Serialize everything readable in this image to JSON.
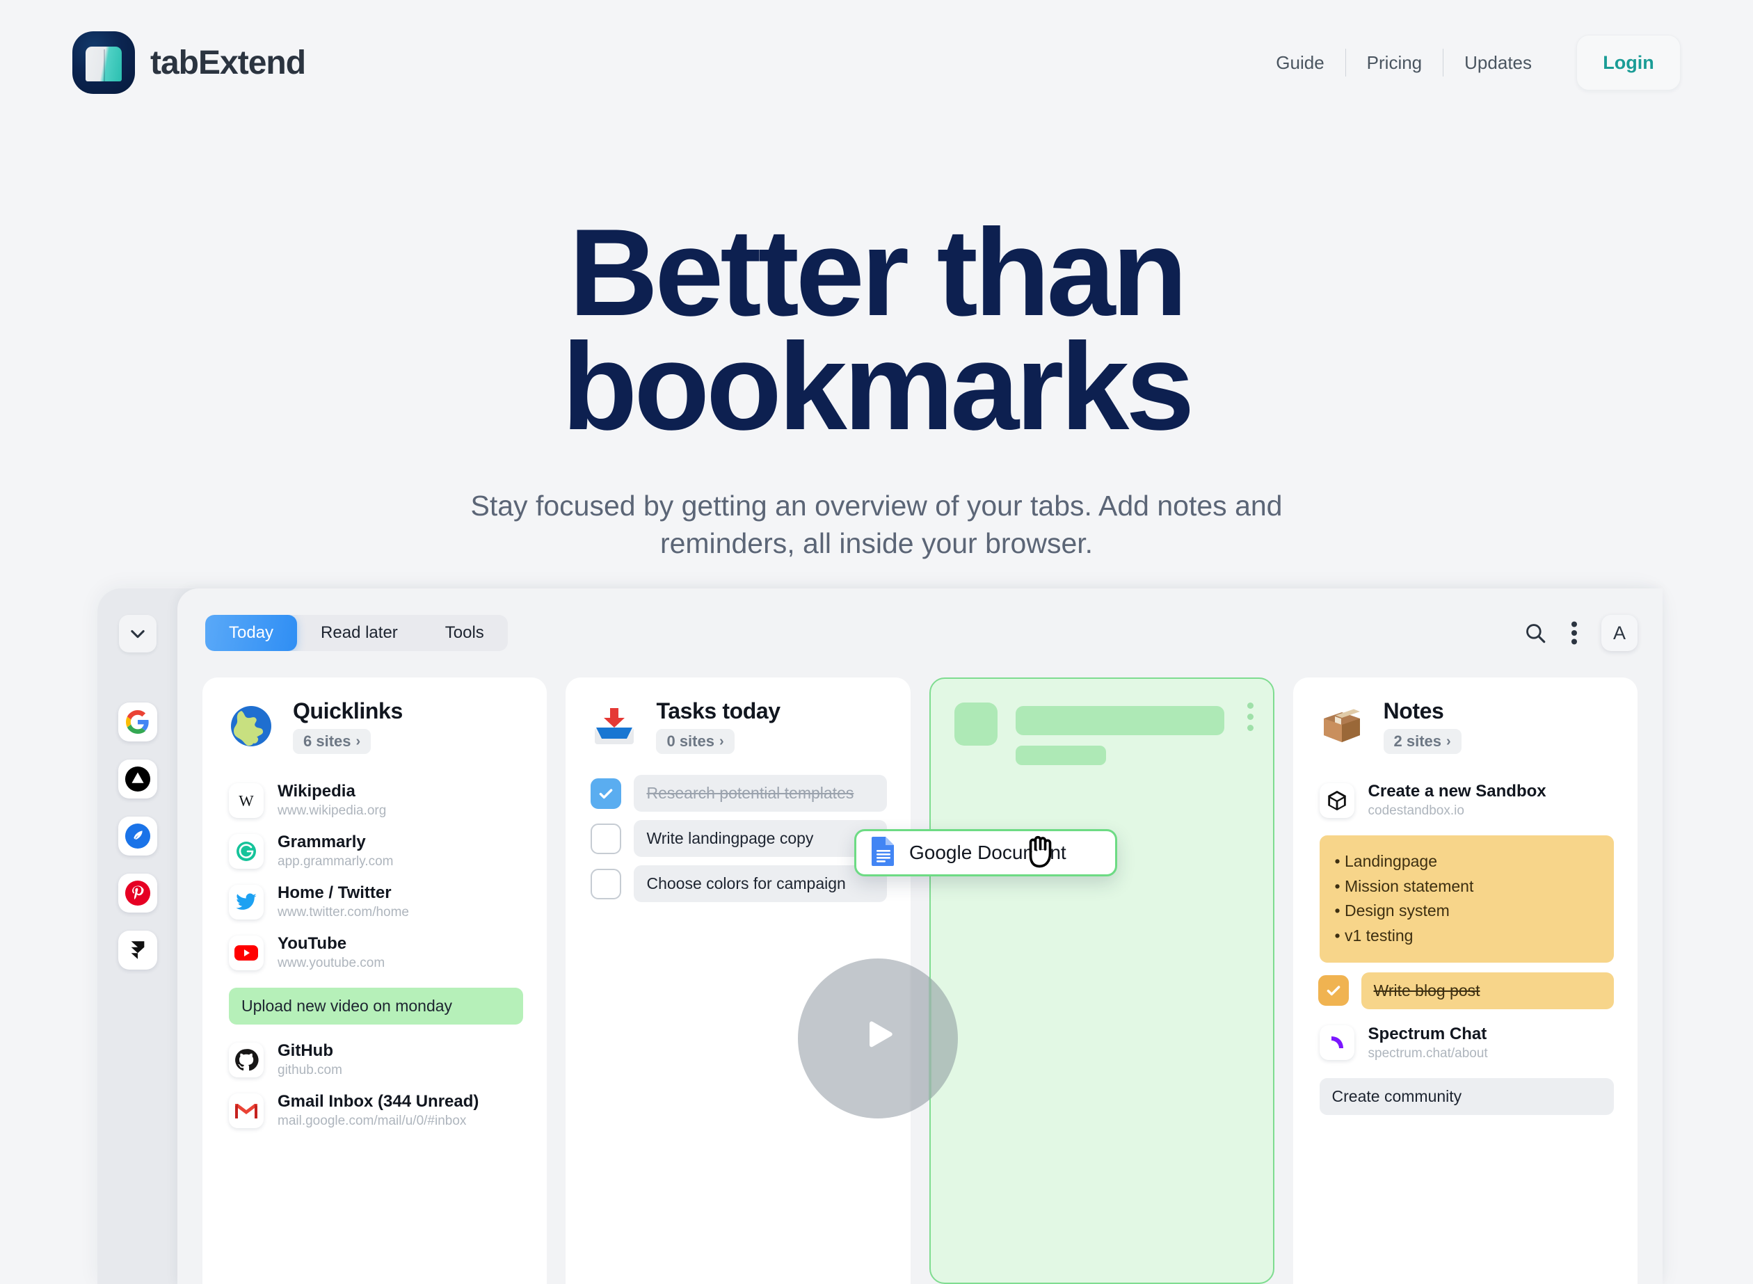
{
  "header": {
    "brand_name": "tabExtend",
    "nav": [
      {
        "label": "Guide"
      },
      {
        "label": "Pricing"
      },
      {
        "label": "Updates"
      }
    ],
    "login_label": "Login"
  },
  "hero": {
    "title_line1": "Better than",
    "title_line2": "bookmarks",
    "subtitle": "Stay focused by getting an overview of your tabs. Add notes and reminders, all inside your browser.",
    "play_label": "Play video"
  },
  "app": {
    "tabs": [
      {
        "label": "Today",
        "active": true
      },
      {
        "label": "Read later",
        "active": false
      },
      {
        "label": "Tools",
        "active": false
      }
    ],
    "toolbar": {
      "search_icon": "search-icon",
      "more_icon": "more-vertical-icon",
      "avatar_label": "A"
    },
    "sidebar": {
      "collapse_icon": "chevron-down-icon",
      "items": [
        {
          "icon": "google-icon",
          "name": "Google"
        },
        {
          "icon": "vercel-icon",
          "name": "Vercel"
        },
        {
          "icon": "quill-icon",
          "name": "Write"
        },
        {
          "icon": "pinterest-icon",
          "name": "Pinterest"
        },
        {
          "icon": "framer-icon",
          "name": "Framer"
        }
      ]
    },
    "columns": {
      "quicklinks": {
        "emoji": "globe-emoji",
        "title": "Quicklinks",
        "count": "6 sites",
        "chevron": "›",
        "items": [
          {
            "kind": "site",
            "icon": "wikipedia-icon",
            "name": "Wikipedia",
            "url": "www.wikipedia.org"
          },
          {
            "kind": "site",
            "icon": "grammarly-icon",
            "name": "Grammarly",
            "url": "app.grammarly.com"
          },
          {
            "kind": "site",
            "icon": "twitter-icon",
            "name": "Home / Twitter",
            "url": "www.twitter.com/home"
          },
          {
            "kind": "site",
            "icon": "youtube-icon",
            "name": "YouTube",
            "url": "www.youtube.com"
          },
          {
            "kind": "note-green",
            "text": "Upload new video on monday"
          },
          {
            "kind": "site",
            "icon": "github-icon",
            "name": "GitHub",
            "url": "github.com"
          },
          {
            "kind": "site",
            "icon": "gmail-icon",
            "name": "Gmail Inbox (344 Unread)",
            "url": "mail.google.com/mail/u/0/#inbox"
          }
        ]
      },
      "tasks": {
        "emoji": "inbox-tray-emoji",
        "title": "Tasks today",
        "count": "0 sites",
        "chevron": "›",
        "items": [
          {
            "kind": "task",
            "text": "Research potential templates",
            "checked": true
          },
          {
            "kind": "task",
            "text": "Write landingpage copy",
            "checked": false
          },
          {
            "kind": "task",
            "text": "Choose colors for campaign",
            "checked": false
          }
        ]
      },
      "dropzone": {
        "more_icon": "more-vertical-icon",
        "state": "drop-target"
      },
      "notes": {
        "emoji": "package-emoji",
        "title": "Notes",
        "count": "2 sites",
        "chevron": "›",
        "items": [
          {
            "kind": "site",
            "icon": "codesandbox-icon",
            "name": "Create a new Sandbox",
            "url": "codestandbox.io"
          },
          {
            "kind": "note-yellow",
            "lines": [
              "Landingpage",
              "Mission statement",
              "Design system",
              "v1 testing"
            ]
          },
          {
            "kind": "task-amber",
            "text": "Write blog post",
            "checked": true
          },
          {
            "kind": "site",
            "icon": "spectrum-icon",
            "name": "Spectrum Chat",
            "url": "spectrum.chat/about"
          },
          {
            "kind": "note-gray",
            "text": "Create community"
          }
        ]
      }
    },
    "drag_card": {
      "icon": "google-docs-icon",
      "label": "Google Document",
      "cursor": "grabbing-hand-cursor"
    }
  },
  "colors": {
    "brand_navy": "#0d2050",
    "accent_teal": "#1a9c96",
    "tab_blue": "#2f8ef4",
    "drop_green": "#7fdc90",
    "note_yellow": "#f7d58a",
    "note_green": "#b6f0b9",
    "page_bg": "#f4f5f7"
  }
}
